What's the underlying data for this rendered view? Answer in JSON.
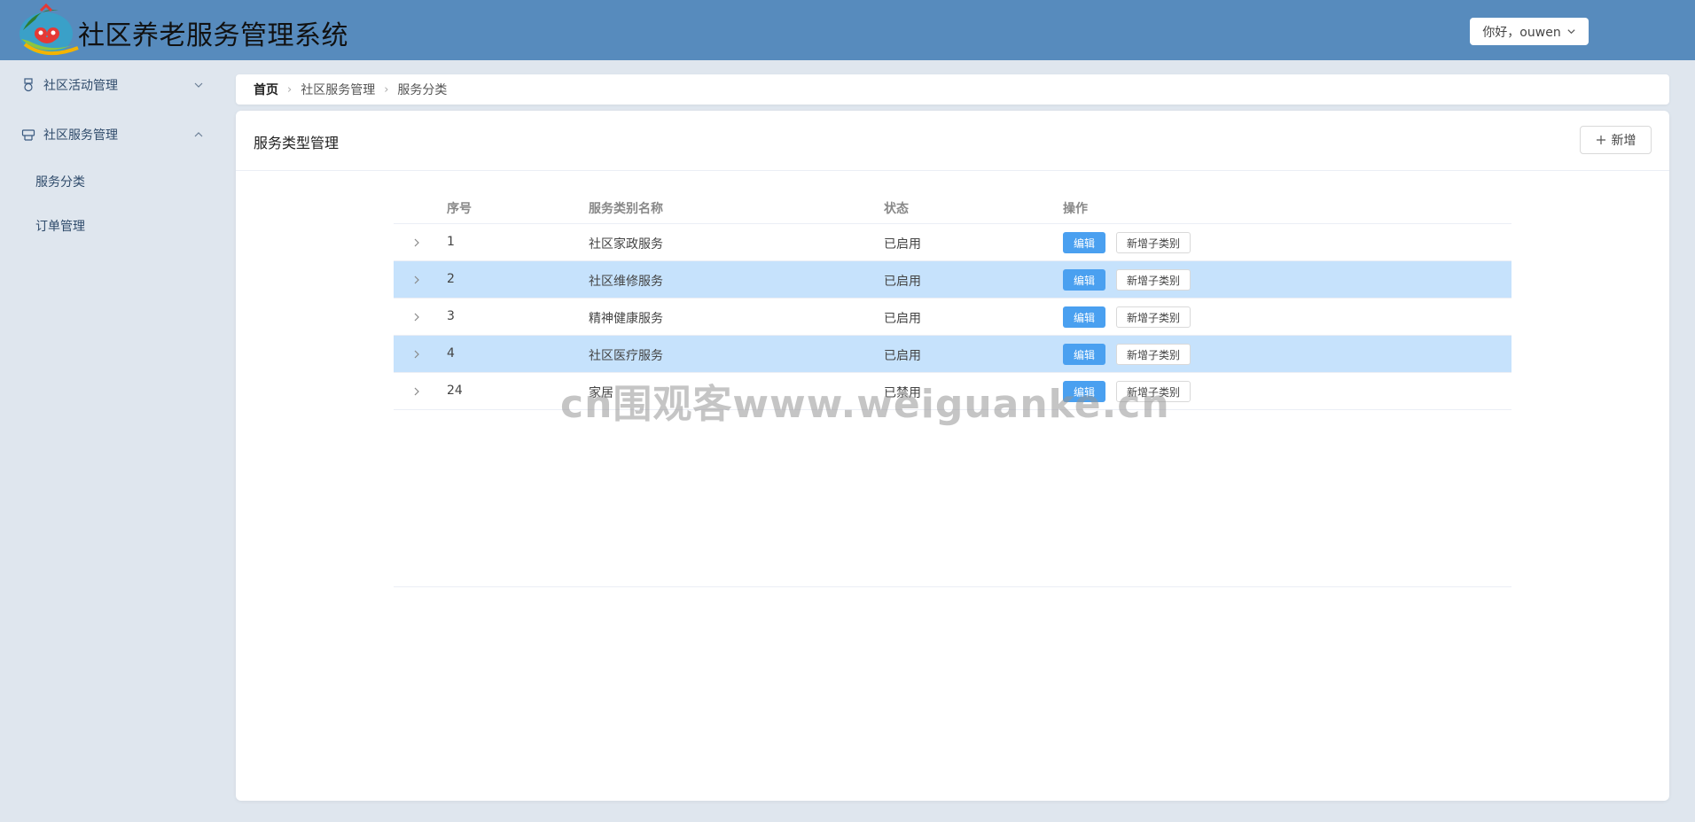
{
  "header": {
    "app_title": "社区养老服务管理系统",
    "user_greeting": "你好，ouwen",
    "bg_color": "#578bbd"
  },
  "sidebar": {
    "groups": [
      {
        "label": "社区活动管理",
        "icon": "medal-icon",
        "expanded": false
      },
      {
        "label": "社区服务管理",
        "icon": "service-icon",
        "expanded": true
      }
    ],
    "sub_items": [
      {
        "label": "服务分类"
      },
      {
        "label": "订单管理"
      }
    ]
  },
  "breadcrumb": {
    "items": [
      "首页",
      "社区服务管理",
      "服务分类"
    ]
  },
  "card": {
    "title": "服务类型管理",
    "add_label": "新增"
  },
  "table": {
    "columns": [
      "序号",
      "服务类别名称",
      "状态",
      "操作"
    ],
    "rows": [
      {
        "id": "1",
        "name": "社区家政服务",
        "status": "已启用",
        "highlighted": false
      },
      {
        "id": "2",
        "name": "社区维修服务",
        "status": "已启用",
        "highlighted": true
      },
      {
        "id": "3",
        "name": "精神健康服务",
        "status": "已启用",
        "highlighted": false
      },
      {
        "id": "4",
        "name": "社区医疗服务",
        "status": "已启用",
        "highlighted": true
      },
      {
        "id": "24",
        "name": "家居",
        "status": "已禁用",
        "highlighted": false
      }
    ],
    "edit_label": "编辑",
    "add_sub_label": "新增子类别"
  },
  "watermark": "cn围观客www.weiguanke.cn"
}
